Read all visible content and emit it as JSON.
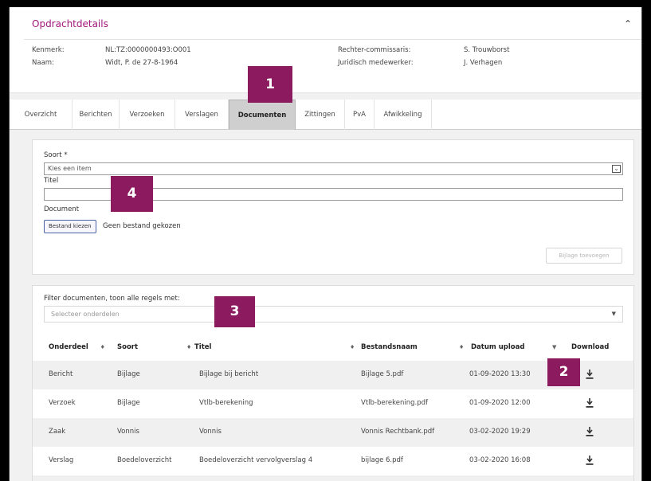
{
  "details": {
    "title": "Opdrachtdetails",
    "kenmerk_label": "Kenmerk:",
    "kenmerk_value": "NL:TZ:0000000493:O001",
    "naam_label": "Naam:",
    "naam_value": "Widt, P. de 27-8-1964",
    "rc_label": "Rechter-commissaris:",
    "rc_value": "S. Trouwborst",
    "jm_label": "Juridisch medewerker:",
    "jm_value": "J. Verhagen"
  },
  "tabs": [
    "Overzicht",
    "Berichten",
    "Verzoeken",
    "Verslagen",
    "Documenten",
    "Zittingen",
    "PvA",
    "Afwikkeling"
  ],
  "active_tab": "Documenten",
  "form": {
    "soort_label": "Soort *",
    "soort_value": "Kies een item",
    "titel_label": "Titel",
    "titel_value": "",
    "document_label": "Document",
    "file_button": "Bestand kiezen",
    "file_status": "Geen bestand gekozen",
    "add_button": "Bijlage toevoegen"
  },
  "filter": {
    "label": "Filter documenten, toon alle regels met:",
    "placeholder": "Selecteer onderdelen"
  },
  "table": {
    "columns": [
      "Onderdeel",
      "Soort",
      "Titel",
      "Bestandsnaam",
      "Datum upload",
      "Download"
    ],
    "rows": [
      [
        "Bericht",
        "Bijlage",
        "Bijlage bij bericht",
        "Bijlage 5.pdf",
        "01-09-2020 13:30"
      ],
      [
        "Verzoek",
        "Bijlage",
        "Vtlb-berekening",
        "Vtlb-berekening.pdf",
        "01-09-2020 12:00"
      ],
      [
        "Zaak",
        "Vonnis",
        "Vonnis",
        "Vonnis Rechtbank.pdf",
        "03-02-2020 19:29"
      ],
      [
        "Verslag",
        "Boedeloverzicht",
        "Boedeloverzicht vervolgverslag 4",
        "bijlage 6.pdf",
        "03-02-2020 16:08"
      ]
    ]
  },
  "badges": [
    "1",
    "2",
    "3",
    "4"
  ],
  "colors": {
    "accent": "#a0167a",
    "badge": "#8c1a5f"
  }
}
